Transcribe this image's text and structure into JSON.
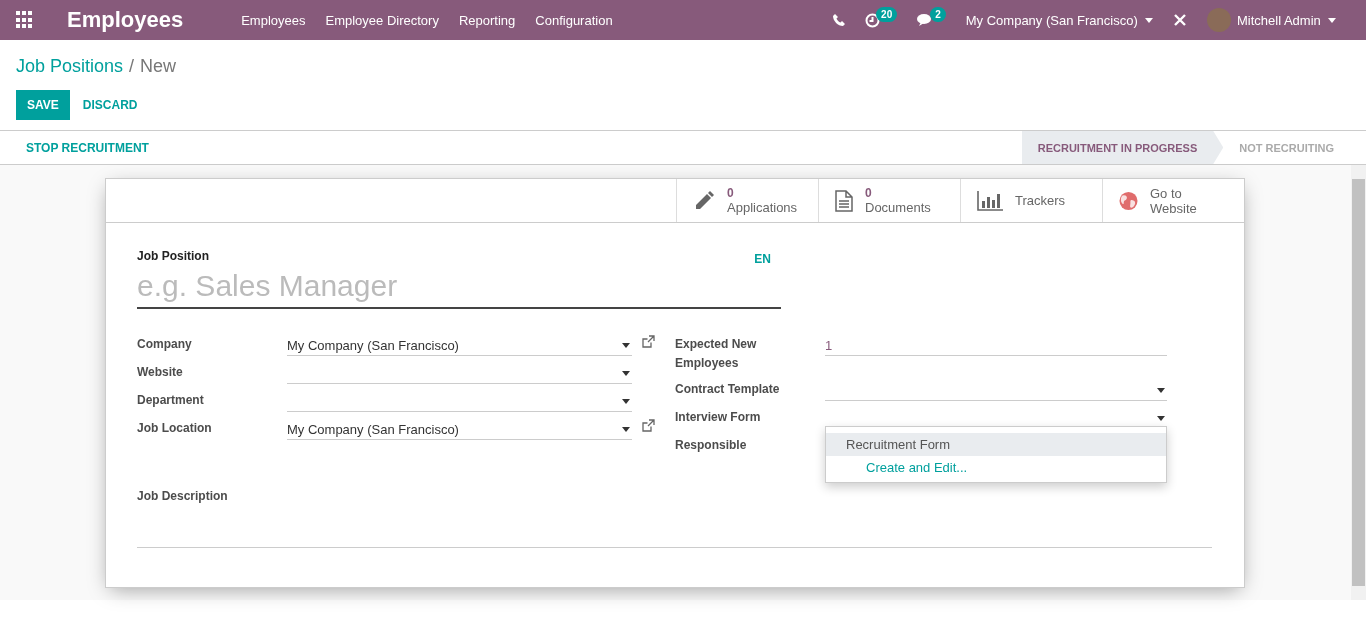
{
  "navbar": {
    "app_title": "Employees",
    "menu": [
      "Employees",
      "Employee Directory",
      "Reporting",
      "Configuration"
    ],
    "activity_count": "20",
    "message_count": "2",
    "company": "My Company (San Francisco)",
    "user": "Mitchell Admin"
  },
  "breadcrumb_separator": "/",
  "breadcrumb": [
    {
      "label": "Job Positions",
      "current": false
    },
    {
      "label": "New",
      "current": true
    }
  ],
  "buttons": [
    {
      "label": "SAVE",
      "kind": "primary"
    },
    {
      "label": "DISCARD",
      "kind": "link"
    }
  ],
  "statusbar": {
    "action": "STOP RECRUITMENT",
    "stages": [
      {
        "label": "RECRUITMENT IN PROGRESS",
        "selected": true
      },
      {
        "label": "NOT RECRUITING",
        "selected": false
      }
    ]
  },
  "smart_buttons": [
    {
      "value": "0",
      "label": "Applications"
    },
    {
      "value": "0",
      "label": "Documents"
    },
    {
      "label": "Trackers"
    },
    {
      "label": "Go to Website"
    }
  ],
  "form": {
    "title_label": "Job Position",
    "title_placeholder": "e.g. Sales Manager",
    "language": "EN",
    "left_fields": [
      {
        "label": "Company",
        "value": "My Company (San Francisco)",
        "external_link": true
      },
      {
        "label": "Website",
        "external_link": false
      },
      {
        "label": "Department",
        "external_link": false
      },
      {
        "label": "Job Location",
        "value": "My Company (San Francisco)",
        "external_link": true
      }
    ],
    "right_fields": [
      {
        "label": "Expected New Employees",
        "value": "1",
        "kind": "number"
      },
      {
        "label": "Contract Template",
        "kind": "select",
        "open": false
      },
      {
        "label": "Interview Form",
        "kind": "select",
        "open": true
      },
      {
        "label": "Responsible",
        "kind": "select",
        "open": false
      }
    ],
    "description_label": "Job Description"
  },
  "dropdown": [
    {
      "label": "Recruitment Form",
      "kind": "option",
      "selected": true
    },
    {
      "label": "Create and Edit...",
      "kind": "action",
      "selected": false
    }
  ]
}
